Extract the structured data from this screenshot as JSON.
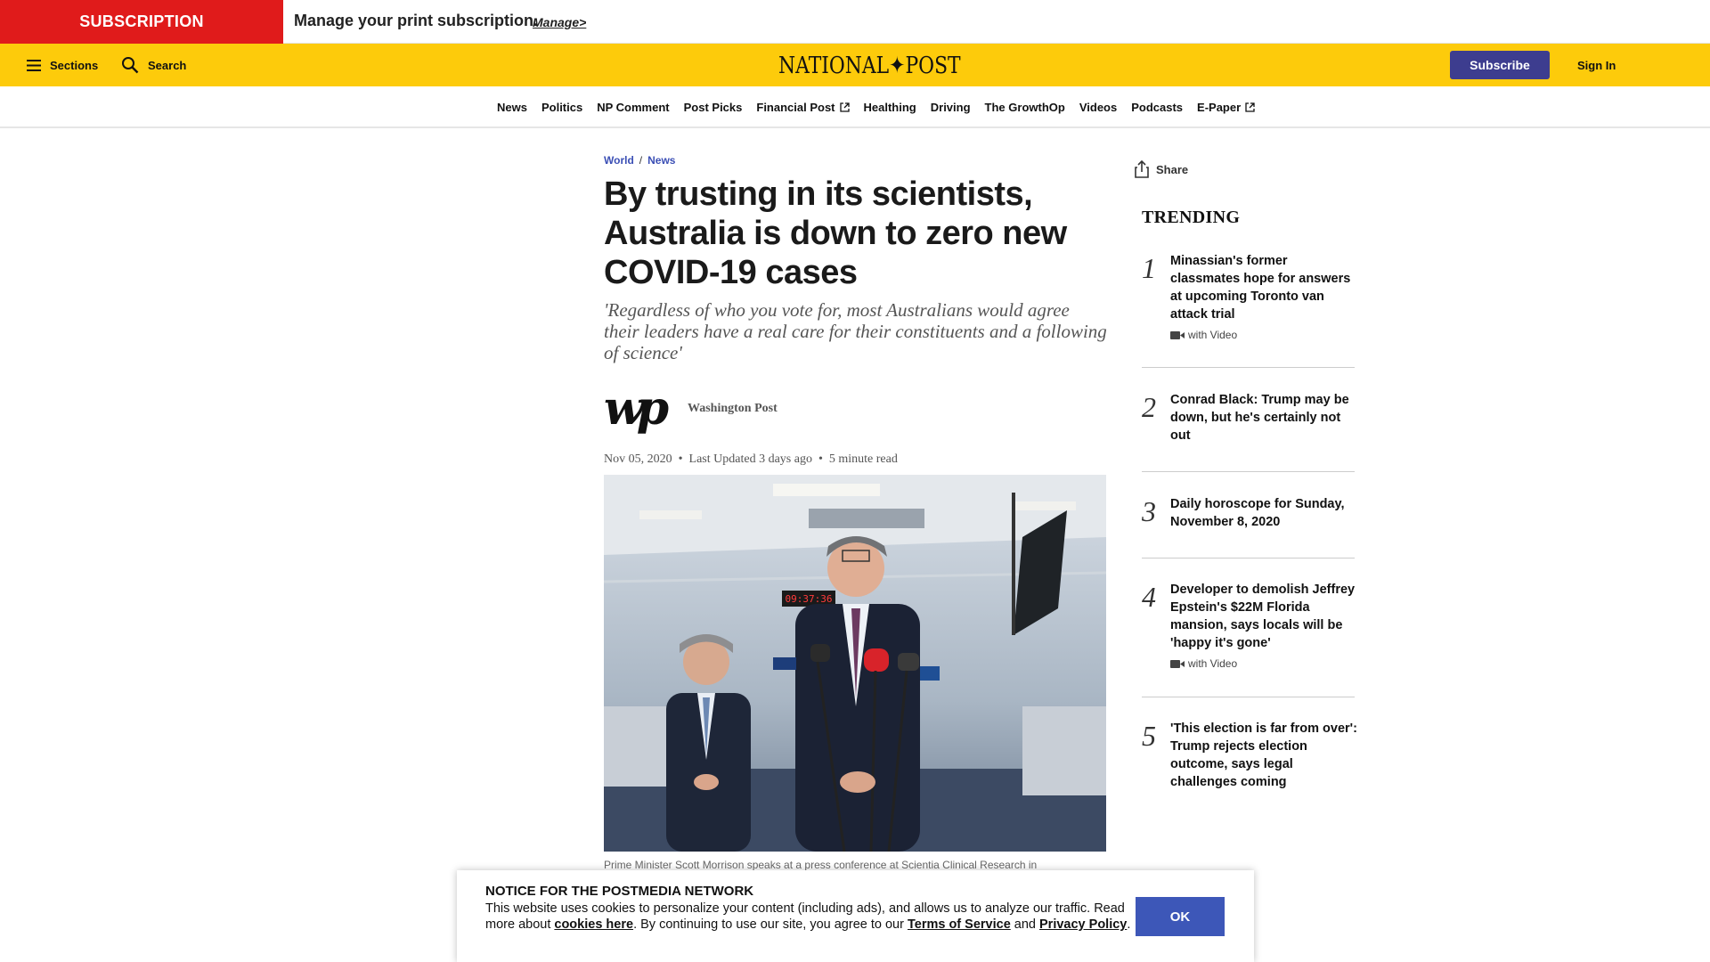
{
  "subscription_bar": {
    "tag": "SUBSCRIPTION",
    "message": "Manage your print subscription.",
    "manage_link": "Manage>"
  },
  "header": {
    "sections_label": "Sections",
    "search_label": "Search",
    "logo": "NATIONAL✦POST",
    "subscribe_label": "Subscribe",
    "signin_label": "Sign In"
  },
  "nav": {
    "items": [
      {
        "label": "News"
      },
      {
        "label": "Politics"
      },
      {
        "label": "NP Comment"
      },
      {
        "label": "Post Picks"
      },
      {
        "label": "Financial Post",
        "external": true
      },
      {
        "label": "Healthing"
      },
      {
        "label": "Driving"
      },
      {
        "label": "The GrowthOp"
      },
      {
        "label": "Videos"
      },
      {
        "label": "Podcasts"
      },
      {
        "label": "E-Paper",
        "external": true
      }
    ]
  },
  "article": {
    "breadcrumb": [
      "World",
      "News"
    ],
    "title": "By trusting in its scientists, Australia is down to zero new COVID-19 cases",
    "dek": "'Regardless of who you vote for, most Australians would agree their leaders have a real care for their constituents and a following of science'",
    "author_logo": "wp",
    "author": "Washington Post",
    "date": "Nov 05, 2020",
    "updated": "Last Updated 3 days ago",
    "read_time": "5 minute read",
    "photo_clock": "09:37:36",
    "caption": "Prime Minister Scott Morrison speaks at a press conference at Scientia Clinical Research in"
  },
  "share_label": "Share",
  "trending": {
    "heading": "TRENDING",
    "items": [
      {
        "num": "1",
        "title": "Minassian's former classmates hope for answers at upcoming Toronto van attack trial",
        "video": "with Video"
      },
      {
        "num": "2",
        "title": "Conrad Black: Trump may be down, but he's certainly not out",
        "video": ""
      },
      {
        "num": "3",
        "title": "Daily horoscope for Sunday, November 8, 2020",
        "video": ""
      },
      {
        "num": "4",
        "title": "Developer to demolish Jeffrey Epstein's $22M Florida mansion, says locals will be 'happy it's gone'",
        "video": "with Video"
      },
      {
        "num": "5",
        "title": "'This election is far from over': Trump rejects election outcome, says legal challenges coming",
        "video": ""
      }
    ]
  },
  "cookie": {
    "heading": "NOTICE FOR THE POSTMEDIA NETWORK",
    "line1": "This website uses cookies to personalize your content (including ads), and allows us to analyze our traffic. Read more about ",
    "cookies_link": "cookies here",
    "line2": ". By continuing to use our site, you agree to our ",
    "terms_link": "Terms of Service",
    "and": " and ",
    "privacy_link": "Privacy Policy",
    "end": ".",
    "ok_label": "OK"
  },
  "colors": {
    "subscription_red": "#e01b1b",
    "header_yellow": "#fdcb0b",
    "subscribe_button": "#3d3d8f",
    "link_blue": "#3b4fb5",
    "ok_button": "#3d57b8"
  }
}
